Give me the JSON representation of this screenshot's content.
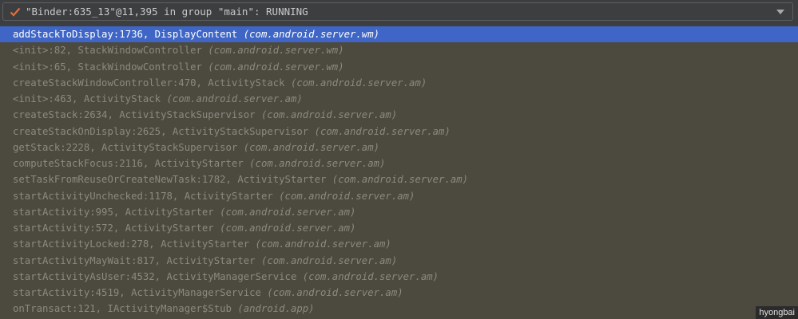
{
  "thread_selector": {
    "label": "\"Binder:635_13\"@11,395 in group \"main\": RUNNING",
    "status_icon": "check-icon",
    "accent": "#e0703a"
  },
  "frames": [
    {
      "method": "addStackToDisplay:1736, DisplayContent",
      "pkg": "(com.android.server.wm)",
      "selected": true
    },
    {
      "method": "<init>:82, StackWindowController",
      "pkg": "(com.android.server.wm)"
    },
    {
      "method": "<init>:65, StackWindowController",
      "pkg": "(com.android.server.wm)"
    },
    {
      "method": "createStackWindowController:470, ActivityStack",
      "pkg": "(com.android.server.am)"
    },
    {
      "method": "<init>:463, ActivityStack",
      "pkg": "(com.android.server.am)"
    },
    {
      "method": "createStack:2634, ActivityStackSupervisor",
      "pkg": "(com.android.server.am)"
    },
    {
      "method": "createStackOnDisplay:2625, ActivityStackSupervisor",
      "pkg": "(com.android.server.am)"
    },
    {
      "method": "getStack:2228, ActivityStackSupervisor",
      "pkg": "(com.android.server.am)"
    },
    {
      "method": "computeStackFocus:2116, ActivityStarter",
      "pkg": "(com.android.server.am)"
    },
    {
      "method": "setTaskFromReuseOrCreateNewTask:1782, ActivityStarter",
      "pkg": "(com.android.server.am)"
    },
    {
      "method": "startActivityUnchecked:1178, ActivityStarter",
      "pkg": "(com.android.server.am)"
    },
    {
      "method": "startActivity:995, ActivityStarter",
      "pkg": "(com.android.server.am)"
    },
    {
      "method": "startActivity:572, ActivityStarter",
      "pkg": "(com.android.server.am)"
    },
    {
      "method": "startActivityLocked:278, ActivityStarter",
      "pkg": "(com.android.server.am)"
    },
    {
      "method": "startActivityMayWait:817, ActivityStarter",
      "pkg": "(com.android.server.am)"
    },
    {
      "method": "startActivityAsUser:4532, ActivityManagerService",
      "pkg": "(com.android.server.am)"
    },
    {
      "method": "startActivity:4519, ActivityManagerService",
      "pkg": "(com.android.server.am)"
    },
    {
      "method": "onTransact:121, IActivityManager$Stub",
      "pkg": "(android.app)"
    }
  ],
  "watermark": "hyongbai"
}
